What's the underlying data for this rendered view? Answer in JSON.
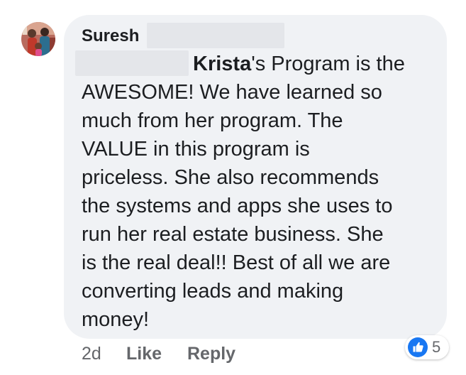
{
  "comment": {
    "author": "Suresh",
    "mention": "Krista",
    "lines": [
      "'s Program is the",
      "AWESOME! We have learned so",
      "much from her program. The",
      "VALUE in this program is",
      "priceless. She also recommends",
      "the systems and apps she uses to",
      "run her real estate business. She",
      "is the real deal!! Best of all we are",
      "converting leads and making",
      "money!"
    ]
  },
  "footer": {
    "time": "2d",
    "like_label": "Like",
    "reply_label": "Reply"
  },
  "reactions": {
    "icon": "thumbs-up-icon",
    "count": "5",
    "color": "#1877f2"
  },
  "colors": {
    "bubble": "#f0f2f5",
    "text": "#1c1e21",
    "meta": "#65676b"
  }
}
